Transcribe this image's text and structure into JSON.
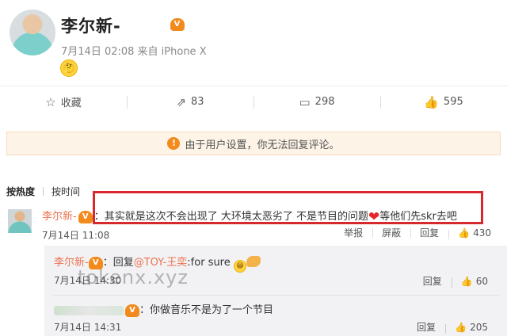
{
  "post": {
    "author": "李尔新-",
    "vip_badge": "V",
    "meta": "7月14日 02:08 来自 iPhone X",
    "emoji": "🤔"
  },
  "actions": {
    "favorite": {
      "icon": "star-icon",
      "label": "收藏"
    },
    "repost": {
      "icon": "share-icon",
      "label": "83"
    },
    "comment": {
      "icon": "comment-icon",
      "label": "298"
    },
    "like": {
      "icon": "thumb-up-icon",
      "label": "595"
    }
  },
  "notice": {
    "icon": "warning-icon",
    "text": "由于用户设置，你无法回复评论。"
  },
  "sort": {
    "hot": "按热度",
    "time": "按时间"
  },
  "comment": {
    "author": "李尔新-",
    "text_prefix": "：其实就是这次不会出现了 大环境太恶劣了 不是节目的问题",
    "text_suffix": "等他们先skr去吧",
    "time": "7月14日 11:08",
    "report": "举报",
    "block": "屏蔽",
    "reply": "回复",
    "likes": "430"
  },
  "replies": [
    {
      "author": "李尔新-",
      "reply_word": "：回复",
      "mention": "@TOY-王奕",
      "text": ":for sure",
      "time": "7月14日 14:30",
      "reply": "回复",
      "likes": "60"
    },
    {
      "text": "：你做音乐不是为了一个节目",
      "time": "7月14日 14:31",
      "reply": "回复",
      "likes": "205"
    }
  ],
  "watermark": "tokenx.xyz",
  "colors": {
    "accent_link": "#eb7350",
    "highlight_border": "#d8282b",
    "notice_bg": "#fdf3e6",
    "reply_bg": "#f2f2f5"
  }
}
